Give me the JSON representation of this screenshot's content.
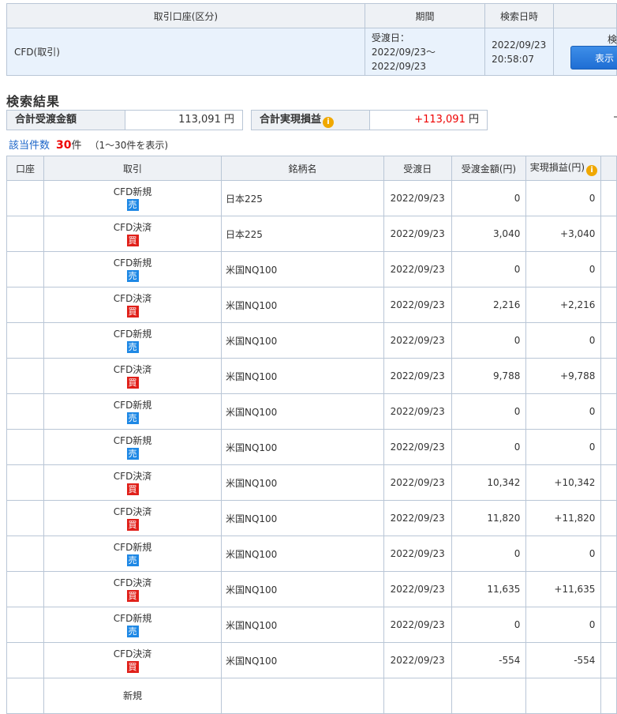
{
  "search_header": {
    "col_account": "取引口座(区分)",
    "col_period": "期間",
    "col_search_time": "検索日時",
    "condition": "CFD(取引)",
    "period_label": "受渡日：",
    "period_value": "2022/09/23〜2022/09/23",
    "search_date": "2022/09/23",
    "search_time": "20:58:07",
    "search_partial_label": "検",
    "display_button": "表示"
  },
  "section_title": "検索結果",
  "totals": {
    "delivery_label": "合計受渡金額",
    "delivery_value": "113,091",
    "delivery_unit": "円",
    "profit_label": "合計実現損益",
    "profit_value": "+113,091",
    "profit_unit": "円"
  },
  "count": {
    "label": "該当件数",
    "number": "30",
    "unit": "件",
    "range": "（1〜30件を表示)"
  },
  "table": {
    "headers": {
      "account": "口座",
      "trade": "取引",
      "name": "銘柄名",
      "date": "受渡日",
      "amount": "受渡金額(円)",
      "profit": "実現損益(円)"
    },
    "rows": [
      {
        "trade": "CFD新規",
        "side": "売",
        "side_type": "sell",
        "name": "日本225",
        "date": "2022/09/23",
        "amount": "0",
        "profit": "0",
        "profit_sign": "zero"
      },
      {
        "trade": "CFD決済",
        "side": "買",
        "side_type": "buy",
        "name": "日本225",
        "date": "2022/09/23",
        "amount": "3,040",
        "profit": "+3,040",
        "profit_sign": "pos"
      },
      {
        "trade": "CFD新規",
        "side": "売",
        "side_type": "sell",
        "name": "米国NQ100",
        "date": "2022/09/23",
        "amount": "0",
        "profit": "0",
        "profit_sign": "zero"
      },
      {
        "trade": "CFD決済",
        "side": "買",
        "side_type": "buy",
        "name": "米国NQ100",
        "date": "2022/09/23",
        "amount": "2,216",
        "profit": "+2,216",
        "profit_sign": "pos"
      },
      {
        "trade": "CFD新規",
        "side": "売",
        "side_type": "sell",
        "name": "米国NQ100",
        "date": "2022/09/23",
        "amount": "0",
        "profit": "0",
        "profit_sign": "zero"
      },
      {
        "trade": "CFD決済",
        "side": "買",
        "side_type": "buy",
        "name": "米国NQ100",
        "date": "2022/09/23",
        "amount": "9,788",
        "profit": "+9,788",
        "profit_sign": "pos"
      },
      {
        "trade": "CFD新規",
        "side": "売",
        "side_type": "sell",
        "name": "米国NQ100",
        "date": "2022/09/23",
        "amount": "0",
        "profit": "0",
        "profit_sign": "zero"
      },
      {
        "trade": "CFD新規",
        "side": "売",
        "side_type": "sell",
        "name": "米国NQ100",
        "date": "2022/09/23",
        "amount": "0",
        "profit": "0",
        "profit_sign": "zero"
      },
      {
        "trade": "CFD決済",
        "side": "買",
        "side_type": "buy",
        "name": "米国NQ100",
        "date": "2022/09/23",
        "amount": "10,342",
        "profit": "+10,342",
        "profit_sign": "pos"
      },
      {
        "trade": "CFD決済",
        "side": "買",
        "side_type": "buy",
        "name": "米国NQ100",
        "date": "2022/09/23",
        "amount": "11,820",
        "profit": "+11,820",
        "profit_sign": "pos"
      },
      {
        "trade": "CFD新規",
        "side": "売",
        "side_type": "sell",
        "name": "米国NQ100",
        "date": "2022/09/23",
        "amount": "0",
        "profit": "0",
        "profit_sign": "zero"
      },
      {
        "trade": "CFD決済",
        "side": "買",
        "side_type": "buy",
        "name": "米国NQ100",
        "date": "2022/09/23",
        "amount": "11,635",
        "profit": "+11,635",
        "profit_sign": "pos"
      },
      {
        "trade": "CFD新規",
        "side": "売",
        "side_type": "sell",
        "name": "米国NQ100",
        "date": "2022/09/23",
        "amount": "0",
        "profit": "0",
        "profit_sign": "zero"
      },
      {
        "trade": "CFD決済",
        "side": "買",
        "side_type": "buy",
        "name": "米国NQ100",
        "date": "2022/09/23",
        "amount": "-554",
        "profit": "-554",
        "profit_sign": "neg"
      },
      {
        "trade": "新規",
        "side": "",
        "side_type": "",
        "name": "",
        "date": "",
        "amount": "",
        "profit": "",
        "profit_sign": "zero"
      }
    ]
  },
  "colors": {
    "header_bg": "#eef1f5",
    "border": "#b9c6d6",
    "condition_bg": "#e9f2fc",
    "profit_positive": "#e00000",
    "profit_negative": "#1a3cf0",
    "sell_badge": "#1e88e5",
    "buy_badge": "#e0201a",
    "button_blue": "#1f6ed4",
    "info_icon": "#f0a800"
  },
  "icons": {
    "info": "info-icon"
  }
}
